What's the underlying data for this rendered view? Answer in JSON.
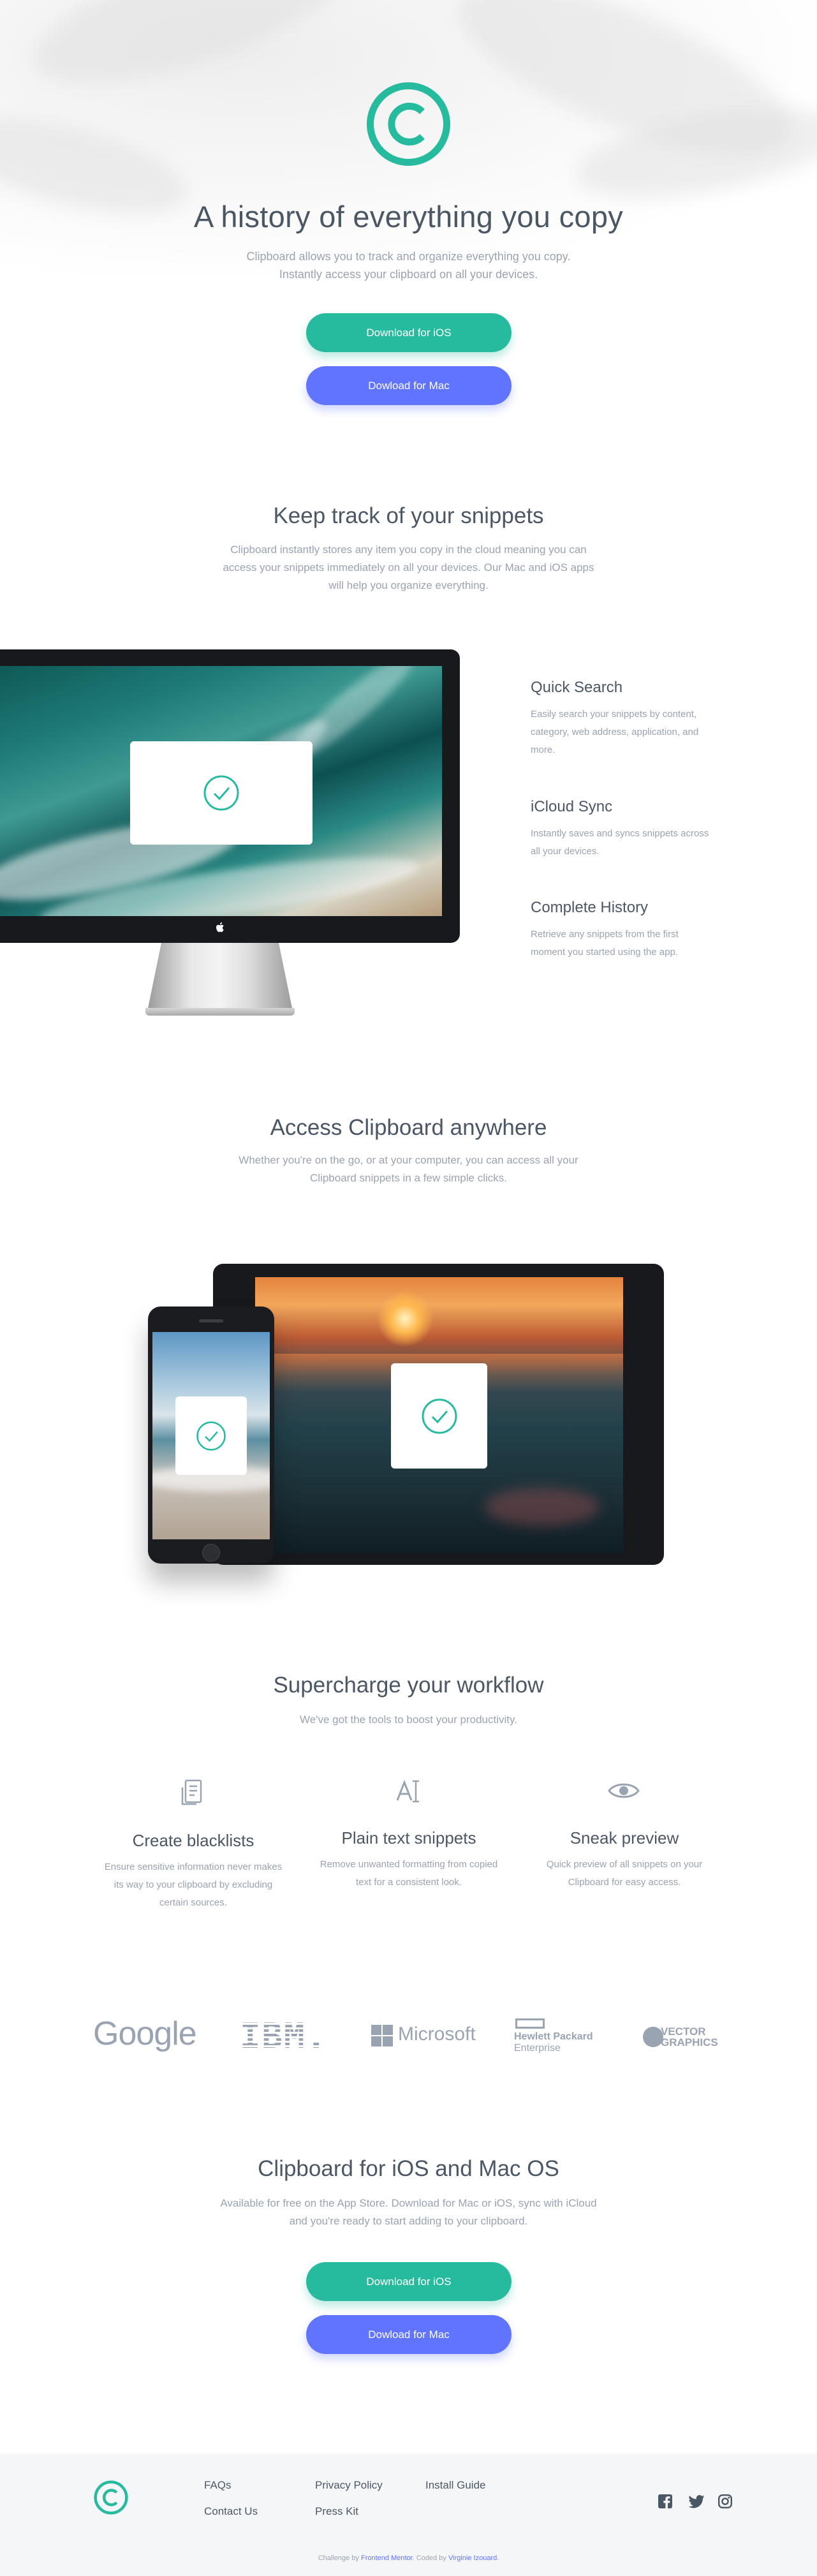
{
  "hero": {
    "title": "A history of everything you copy",
    "subtitle_line1": "Clipboard allows you to track and organize everything you copy.",
    "subtitle_line2": "Instantly access your clipboard on all your devices.",
    "btn_ios": "Download for iOS",
    "btn_mac": "Dowload for Mac"
  },
  "snippets": {
    "title": "Keep track of your snippets",
    "desc_line1": "Clipboard instantly stores any item you copy in the cloud meaning you can",
    "desc_line2": "access your snippets immediately on all your devices. Our Mac and iOS apps",
    "desc_line3": "will help you organize everything.",
    "features": [
      {
        "title": "Quick Search",
        "l1": "Easily search your snippets by content,",
        "l2": "category, web address, application, and",
        "l3": "more."
      },
      {
        "title": "iCloud Sync",
        "l1": "Instantly saves and syncs snippets across",
        "l2": "all your devices.",
        "l3": ""
      },
      {
        "title": "Complete History",
        "l1": "Retrieve any snippets from the first",
        "l2": "moment you started using the app.",
        "l3": ""
      }
    ]
  },
  "access": {
    "title": "Access Clipboard anywhere",
    "desc_line1": "Whether you're on the go, or at your computer, you can access all your",
    "desc_line2": "Clipboard snippets in a few simple clicks."
  },
  "workflow": {
    "title": "Supercharge your workflow",
    "subtitle": "We've got the tools to boost your productivity.",
    "items": [
      {
        "icon": "document-list-icon",
        "title": "Create blacklists",
        "l1": "Ensure sensitive information never makes",
        "l2": "its way to your clipboard by excluding",
        "l3": "certain sources."
      },
      {
        "icon": "text-cursor-icon",
        "title": "Plain text snippets",
        "l1": "Remove unwanted formatting from copied",
        "l2": "text for a consistent look.",
        "l3": ""
      },
      {
        "icon": "eye-icon",
        "title": "Sneak preview",
        "l1": "Quick preview of all snippets on your",
        "l2": "Clipboard for easy access.",
        "l3": ""
      }
    ]
  },
  "partners": {
    "google": "Google",
    "ibm": "IBM.",
    "microsoft": "Microsoft",
    "hp_line1": "Hewlett Packard",
    "hp_line2": "Enterprise",
    "vector_line1": "VECTOR",
    "vector_line2": "GRAPHICS"
  },
  "cta": {
    "title": "Clipboard for iOS and Mac OS",
    "desc_line1": "Available for free on the App Store. Download for Mac or iOS, sync with iCloud",
    "desc_line2": "and you're ready to start adding to your clipboard.",
    "btn_ios": "Download for iOS",
    "btn_mac": "Dowload for Mac"
  },
  "footer": {
    "links": [
      "FAQs",
      "Contact Us",
      "Privacy Policy",
      "Press Kit",
      "Install Guide"
    ],
    "social": [
      "facebook-icon",
      "twitter-icon",
      "instagram-icon"
    ],
    "attribution_prefix": "Challenge by",
    "attribution_fm": "Frontend Mentor",
    "attribution_mid": ". Coded by",
    "attribution_author": "Virginie Izouard",
    "attribution_end": "."
  },
  "colors": {
    "accent_green": "#26ba9f",
    "accent_blue": "#6174ff",
    "heading": "#4c5766",
    "body": "#9aa3b1"
  }
}
